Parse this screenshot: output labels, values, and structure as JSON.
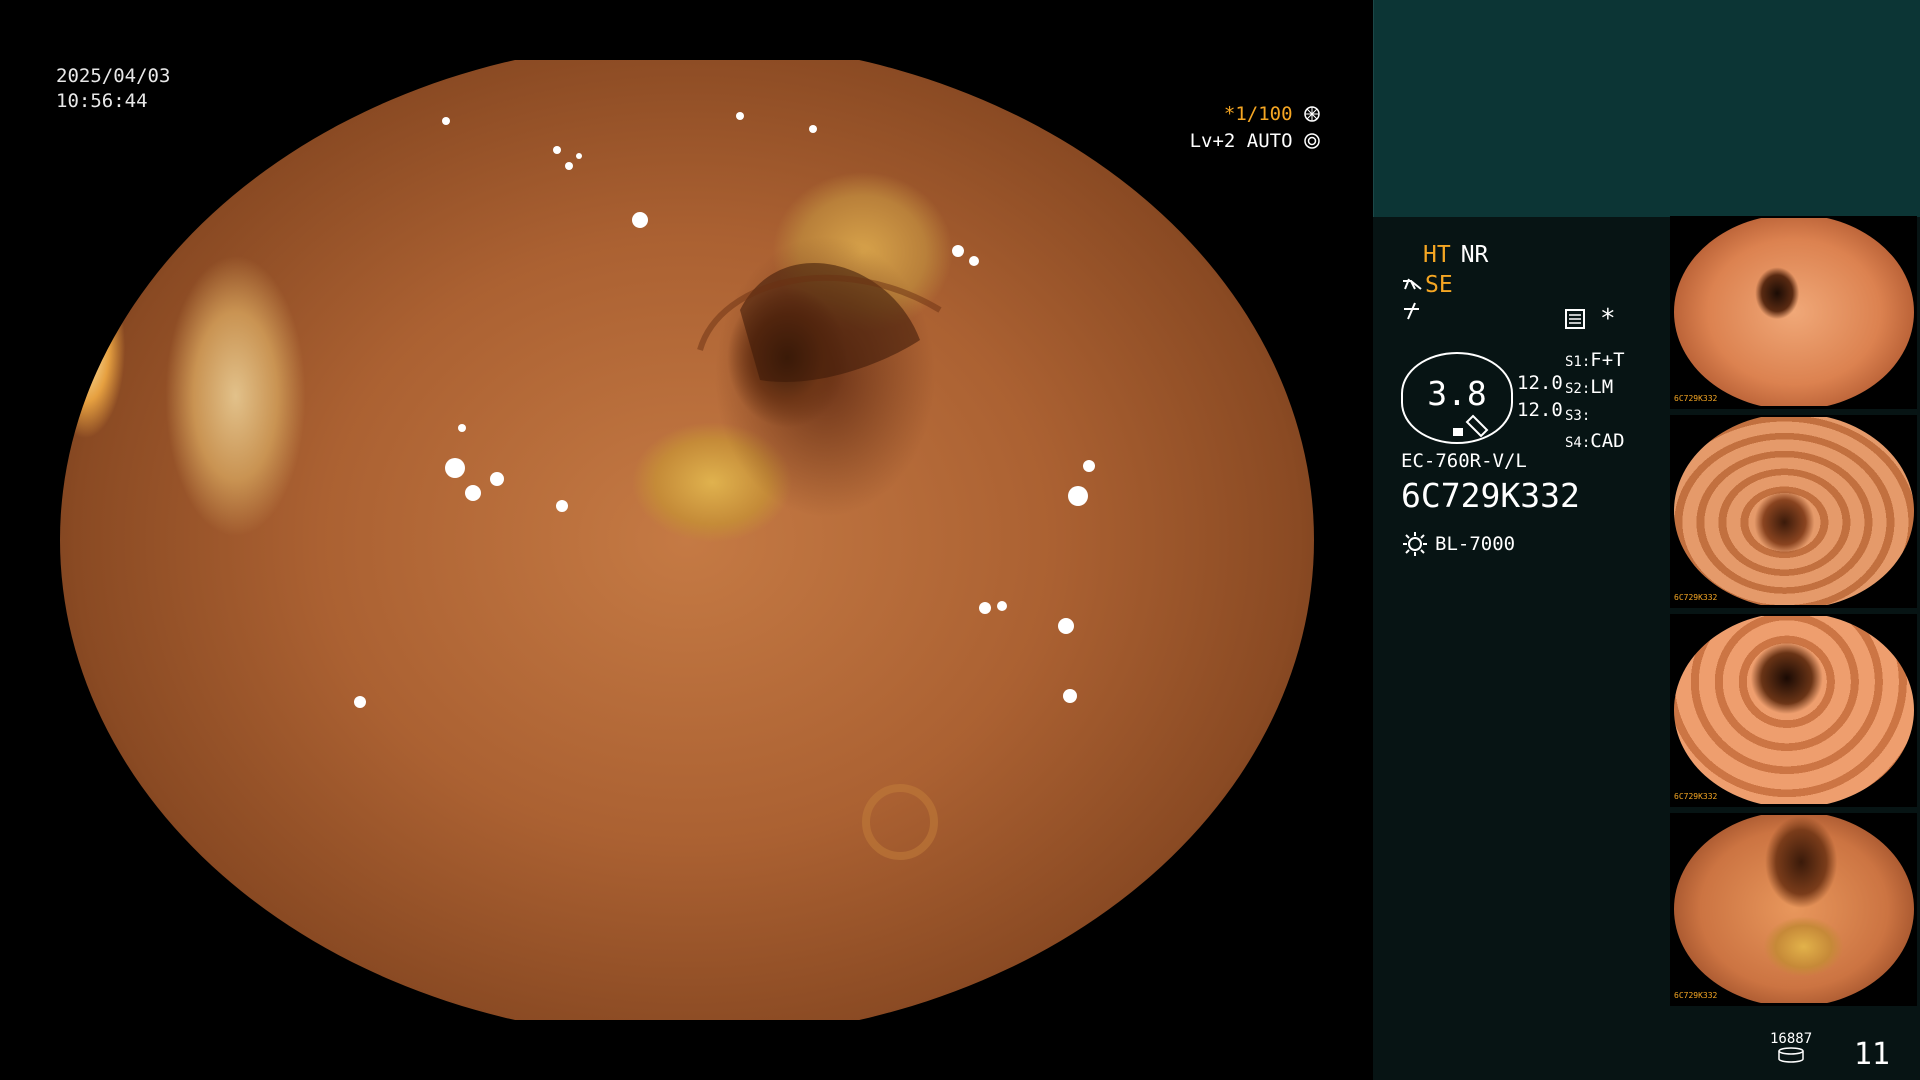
{
  "timestamp": {
    "date": "2025/04/03",
    "time": "10:56:44"
  },
  "osd": {
    "shutter": "*1/100",
    "level": "Lv+2",
    "mode": "AUTO"
  },
  "info": {
    "ht": "HT",
    "nr": "NR",
    "se": "SE",
    "iris_value": "3.8",
    "enhancement_1": "12.0",
    "enhancement_2": "12.0",
    "s1_key": "S1:",
    "s1_val": "F+T",
    "s2_key": "S2:",
    "s2_val": "LM",
    "s3_key": "S3:",
    "s3_val": "",
    "s4_key": "S4:",
    "s4_val": "CAD",
    "asterisk": "*",
    "scope_model": "EC-760R-V/L",
    "scope_serial": "6C729K332",
    "light_source": "BL-7000"
  },
  "thumbnails": [
    {
      "label": "thumbnail-1",
      "id": "6C729K332"
    },
    {
      "label": "thumbnail-2",
      "id": "6C729K332"
    },
    {
      "label": "thumbnail-3",
      "id": "6C729K332"
    },
    {
      "label": "thumbnail-4",
      "id": "6C729K332"
    }
  ],
  "footer": {
    "storage_count": "16887",
    "image_count": "11"
  },
  "colors": {
    "accent": "#f5a623",
    "sidebar_bg": "#071414",
    "sidebar_top": "#0c3535"
  },
  "icons": [
    "shutter-mode-icon",
    "auto-iris-icon",
    "structure-enhance-icon",
    "filter-icon",
    "memo-icon",
    "light-source-icon",
    "storage-disk-icon"
  ]
}
